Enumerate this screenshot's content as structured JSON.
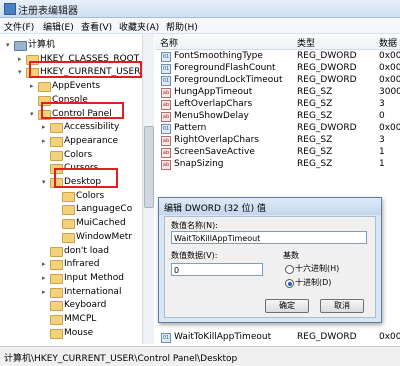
{
  "window": {
    "title": "注册表编辑器"
  },
  "menu": [
    "文件(F)",
    "编辑(E)",
    "查看(V)",
    "收藏夹(A)",
    "帮助(H)"
  ],
  "tree": [
    {
      "label": "计算机",
      "depth": 0,
      "toggle": "▾"
    },
    {
      "label": "HKEY_CLASSES_ROOT",
      "depth": 1,
      "toggle": "▸"
    },
    {
      "label": "HKEY_CURRENT_USER",
      "depth": 1,
      "toggle": "▾"
    },
    {
      "label": "AppEvents",
      "depth": 2,
      "toggle": "▸"
    },
    {
      "label": "Console",
      "depth": 2,
      "toggle": ""
    },
    {
      "label": "Control Panel",
      "depth": 2,
      "toggle": "▾"
    },
    {
      "label": "Accessibility",
      "depth": 3,
      "toggle": "▸"
    },
    {
      "label": "Appearance",
      "depth": 3,
      "toggle": "▸"
    },
    {
      "label": "Colors",
      "depth": 3,
      "toggle": ""
    },
    {
      "label": "Cursors",
      "depth": 3,
      "toggle": ""
    },
    {
      "label": "Desktop",
      "depth": 3,
      "toggle": "▾"
    },
    {
      "label": "Colors",
      "depth": 4,
      "toggle": ""
    },
    {
      "label": "LanguageCo",
      "depth": 4,
      "toggle": ""
    },
    {
      "label": "MuiCached",
      "depth": 4,
      "toggle": ""
    },
    {
      "label": "WindowMetr",
      "depth": 4,
      "toggle": ""
    },
    {
      "label": "don't load",
      "depth": 3,
      "toggle": ""
    },
    {
      "label": "Infrared",
      "depth": 3,
      "toggle": "▸"
    },
    {
      "label": "Input Method",
      "depth": 3,
      "toggle": "▸"
    },
    {
      "label": "International",
      "depth": 3,
      "toggle": "▸"
    },
    {
      "label": "Keyboard",
      "depth": 3,
      "toggle": ""
    },
    {
      "label": "MMCPL",
      "depth": 3,
      "toggle": ""
    },
    {
      "label": "Mouse",
      "depth": 3,
      "toggle": ""
    }
  ],
  "list": {
    "headers": [
      "名称",
      "类型",
      "数据"
    ],
    "rows": [
      {
        "name": "FontSmoothingType",
        "type": "REG_DWORD",
        "data": "0x00"
      },
      {
        "name": "ForegroundFlashCount",
        "type": "REG_DWORD",
        "data": "0x00"
      },
      {
        "name": "ForegroundLockTimeout",
        "type": "REG_DWORD",
        "data": "0x00"
      },
      {
        "name": "HungAppTimeout",
        "type": "REG_SZ",
        "data": "3000"
      },
      {
        "name": "LeftOverlapChars",
        "type": "REG_SZ",
        "data": "3"
      },
      {
        "name": "MenuShowDelay",
        "type": "REG_SZ",
        "data": "0"
      },
      {
        "name": "Pattern",
        "type": "REG_DWORD",
        "data": "0x00"
      },
      {
        "name": "RightOverlapChars",
        "type": "REG_SZ",
        "data": "3"
      },
      {
        "name": "ScreenSaveActive",
        "type": "REG_SZ",
        "data": "1"
      },
      {
        "name": "SnapSizing",
        "type": "REG_SZ",
        "data": "1"
      }
    ],
    "last_row": {
      "name": "WaitToKillAppTimeout",
      "type": "REG_DWORD",
      "data": "0x00"
    }
  },
  "dialog": {
    "title": "编辑 DWORD (32 位) 值",
    "name_label": "数值名称(N):",
    "name_value": "WaitToKillAppTimeout",
    "data_label": "数值数据(V):",
    "data_value": "0",
    "base_label": "基数",
    "base_hex": "十六进制(H)",
    "base_dec": "十进制(D)",
    "ok": "确定",
    "cancel": "取消"
  },
  "status": {
    "path": "计算机\\HKEY_CURRENT_USER\\Control Panel\\Desktop"
  },
  "colors": {
    "highlight": "#e02020",
    "folder": "#f3d27a"
  }
}
